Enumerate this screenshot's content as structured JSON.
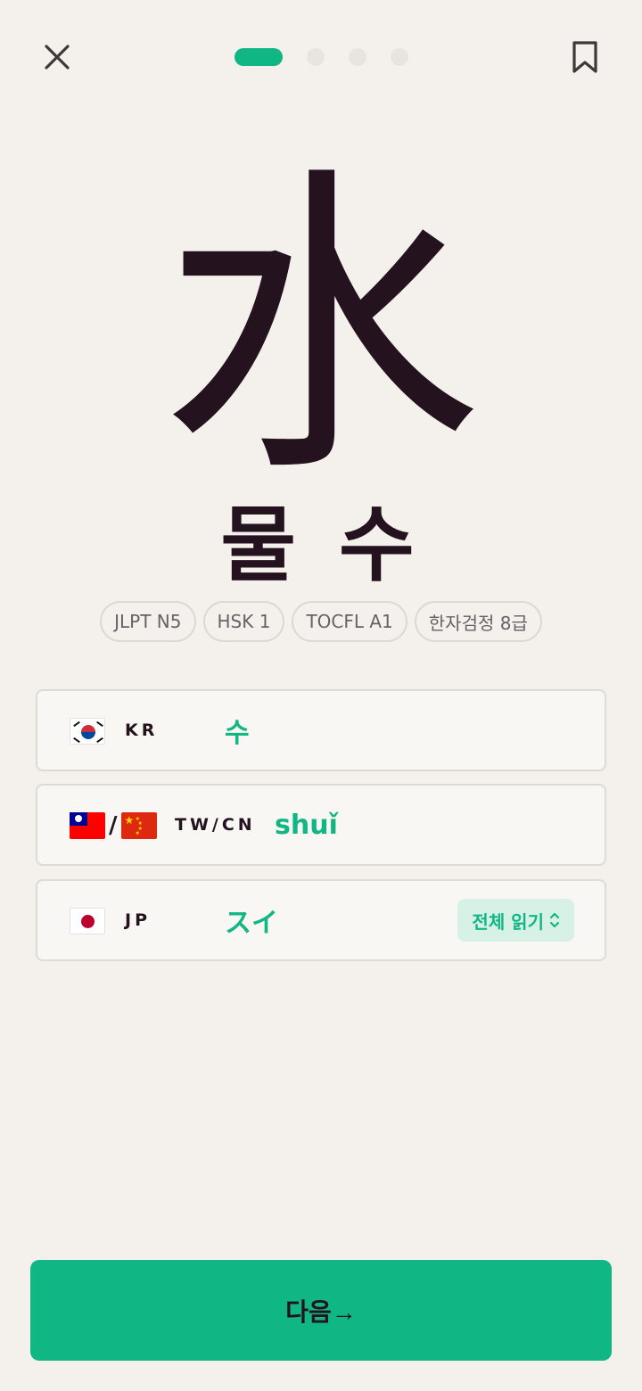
{
  "header": {
    "close_icon": "close-icon",
    "bookmark_icon": "bookmark-icon",
    "progress": {
      "current": 1,
      "total": 4
    }
  },
  "card": {
    "character": "水",
    "meaning": "물 수",
    "tags": [
      "JLPT N5",
      "HSK 1",
      "TOCFL A1",
      "한자검정 8급"
    ]
  },
  "readings": [
    {
      "flags": [
        "kr"
      ],
      "region": "KR",
      "sound": "수"
    },
    {
      "flags": [
        "tw",
        "cn"
      ],
      "flag_separator": "/",
      "region": "TW/CN",
      "sound": "shuǐ"
    },
    {
      "flags": [
        "jp"
      ],
      "region": "JP",
      "sound": "スイ",
      "button_label": "전체 읽기",
      "button_icon": "chevron-updown-icon"
    }
  ],
  "footer": {
    "next_label": "다음→"
  },
  "colors": {
    "accent": "#10b784",
    "accent_soft": "#d7f1e6",
    "background": "#f4f1ec",
    "text": "#24131f"
  }
}
